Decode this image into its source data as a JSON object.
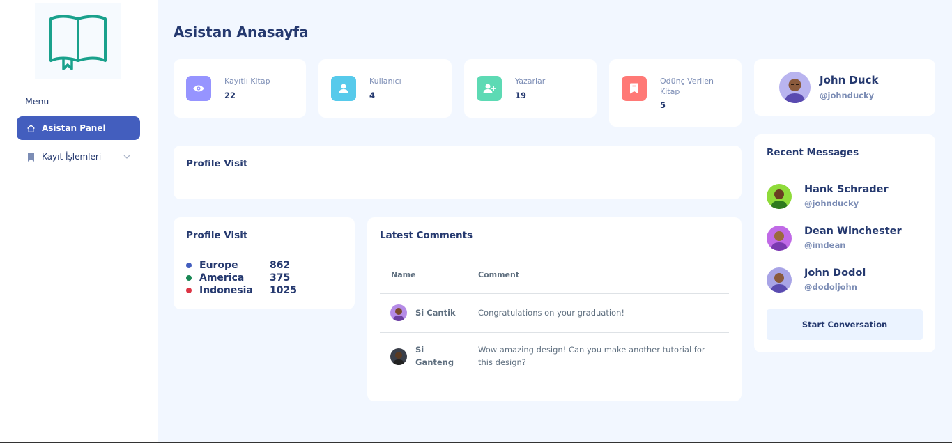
{
  "page_title": "Asistan Anasayfa",
  "sidebar": {
    "menu_title": "Menu",
    "items": [
      {
        "label": "Asistan Panel",
        "icon": "home-icon",
        "active": true
      },
      {
        "label": "Kayıt İşlemleri",
        "icon": "bookmark-icon",
        "active": false
      }
    ]
  },
  "stats": [
    {
      "label": "Kayıtlı Kitap",
      "value": "22",
      "icon": "eye-icon",
      "color": "#9694ff"
    },
    {
      "label": "Kullanıcı",
      "value": "4",
      "icon": "user-icon",
      "color": "#57caeb"
    },
    {
      "label": "Yazarlar",
      "value": "19",
      "icon": "user-plus-icon",
      "color": "#5ddab4"
    },
    {
      "label": "Ödünç Verilen Kitap",
      "value": "5",
      "icon": "bookmark-icon",
      "color": "#ff7976"
    }
  ],
  "profile": {
    "name": "John Duck",
    "handle": "@johnducky"
  },
  "profile_visit_wide": {
    "title": "Profile Visit"
  },
  "profile_visit": {
    "title": "Profile Visit",
    "rows": [
      {
        "region": "Europe",
        "value": "862",
        "color": "#435ebe"
      },
      {
        "region": "America",
        "value": "375",
        "color": "#198754"
      },
      {
        "region": "Indonesia",
        "value": "1025",
        "color": "#dc3545"
      }
    ]
  },
  "comments": {
    "title": "Latest Comments",
    "headers": {
      "name": "Name",
      "comment": "Comment"
    },
    "rows": [
      {
        "name": "Si Cantik",
        "comment": "Congratulations on your graduation!"
      },
      {
        "name": "Si Ganteng",
        "comment": "Wow amazing design! Can you make another tutorial for this design?"
      }
    ]
  },
  "messages": {
    "title": "Recent Messages",
    "items": [
      {
        "name": "Hank Schrader",
        "handle": "@johnducky"
      },
      {
        "name": "Dean Winchester",
        "handle": "@imdean"
      },
      {
        "name": "John Dodol",
        "handle": "@dodoljohn"
      }
    ],
    "button": "Start Conversation"
  },
  "colors": {
    "primary": "#435ebe",
    "background": "#f2f7ff",
    "logo": "#1aa18c"
  }
}
